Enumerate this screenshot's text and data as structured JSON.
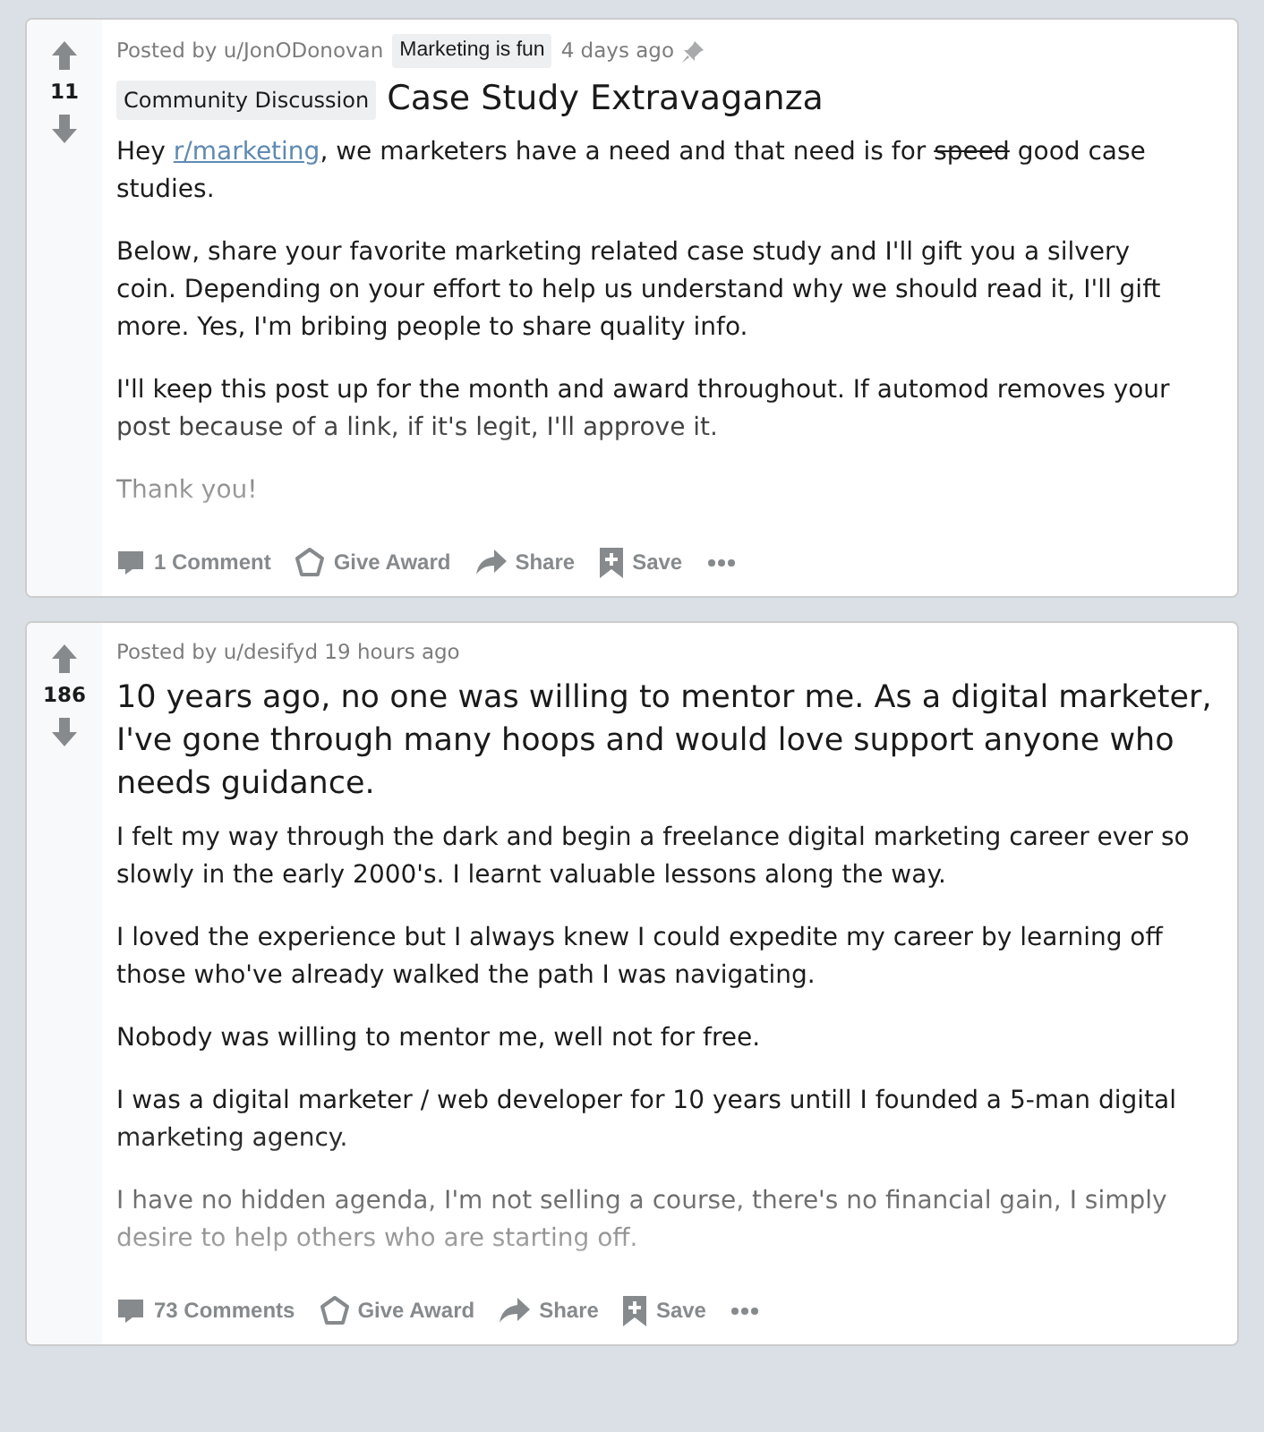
{
  "posts": [
    {
      "votes": "11",
      "posted_by": "Posted by u/JonODonovan",
      "author_flair": "Marketing is fun",
      "time": "4 days ago",
      "pinned": true,
      "title_flair": "Community Discussion",
      "title": "Case Study Extravaganza",
      "paragraphs": [
        [
          {
            "kind": "text",
            "text": "Hey "
          },
          {
            "kind": "link",
            "text": "r/marketing"
          },
          {
            "kind": "text",
            "text": ", we marketers have a need and that need is for "
          },
          {
            "kind": "strike",
            "text": "speed"
          },
          {
            "kind": "text",
            "text": " good case studies."
          }
        ],
        "Below, share your favorite marketing related case study and I'll gift you a silvery coin. Depending on your effort to help us understand why we should read it, I'll gift more. Yes, I'm bribing people to share quality info.",
        "I'll keep this post up for the month and award throughout. If automod removes your post because of a link, if it's legit, I'll approve it.",
        "Thank you!"
      ],
      "actions": {
        "comments": "1 Comment",
        "award": "Give Award",
        "share": "Share",
        "save": "Save"
      }
    },
    {
      "votes": "186",
      "posted_by": "Posted by u/desifyd 19 hours ago",
      "pinned": false,
      "title": "10 years ago, no one was willing to mentor me. As a digital marketer, I've gone through many hoops and would love support anyone who needs guidance.",
      "paragraphs": [
        "I felt my way through the dark and begin a freelance digital marketing career ever so slowly in the early 2000's. I learnt valuable lessons along the way.",
        "I loved the experience but I always knew I could expedite my career by learning off those who've already walked the path I was navigating.",
        "Nobody was willing to mentor me, well not for free.",
        "I was a digital marketer / web developer for 10 years untill I founded a 5-man digital marketing agency.",
        "I have no hidden agenda, I'm not selling a course, there's no financial gain, I simply desire to help others who are starting off."
      ],
      "actions": {
        "comments": "73 Comments",
        "award": "Give Award",
        "share": "Share",
        "save": "Save"
      }
    }
  ]
}
